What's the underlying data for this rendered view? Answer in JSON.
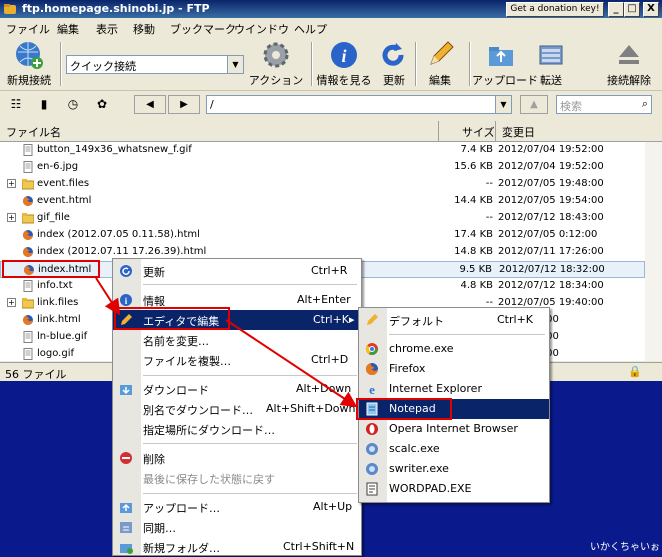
{
  "window": {
    "title": "ftp.homepage.shinobi.jp - FTP",
    "donate_label": "Get a donation key!",
    "minimize": "_",
    "maximize": "□",
    "close": "X"
  },
  "menu": [
    "ファイル",
    "編集",
    "表示",
    "移動",
    "ブックマーク",
    "ウインドウ",
    "ヘルプ"
  ],
  "toolbar": {
    "new_connection": "新規接続",
    "quick_connect": "クイック接続",
    "action": "アクション",
    "info": "情報を見る",
    "refresh": "更新",
    "edit": "編集",
    "upload": "アップロード",
    "transfer": "転送",
    "disconnect": "接続解除"
  },
  "navbar": {
    "path": "/",
    "search_placeholder": "検索"
  },
  "list": {
    "columns": {
      "name": "ファイル名",
      "size": "サイズ",
      "date": "変更日"
    },
    "rows": [
      {
        "name": "button_149x36_whatsnew_f.gif",
        "size": "7.4 KB",
        "date": "2012/07/04 19:52:00",
        "type": "file"
      },
      {
        "name": "en-6.jpg",
        "size": "15.6 KB",
        "date": "2012/07/04 19:52:00",
        "type": "file"
      },
      {
        "name": "event.files",
        "size": "--",
        "date": "2012/07/05 19:48:00",
        "type": "folder"
      },
      {
        "name": "event.html",
        "size": "14.4 KB",
        "date": "2012/07/05 19:54:00",
        "type": "html"
      },
      {
        "name": "gif_file",
        "size": "--",
        "date": "2012/07/12 18:43:00",
        "type": "folder"
      },
      {
        "name": "index (2012.07.05 0.11.58).html",
        "size": "17.4 KB",
        "date": "2012/07/05 0:12:00",
        "type": "html"
      },
      {
        "name": "index (2012.07.11 17.26.39).html",
        "size": "14.8 KB",
        "date": "2012/07/11 17:26:00",
        "type": "html"
      },
      {
        "name": "index.html",
        "size": "9.5 KB",
        "date": "2012/07/12 18:32:00",
        "type": "html"
      },
      {
        "name": "info.txt",
        "size": "4.8 KB",
        "date": "2012/07/12 18:34:00",
        "type": "file"
      },
      {
        "name": "link.files",
        "size": "--",
        "date": "2012/07/05 19:40:00",
        "type": "folder"
      },
      {
        "name": "link.html",
        "size": "",
        "date": "11 22:24:00",
        "type": "html"
      },
      {
        "name": "ln-blue.gif",
        "size": "",
        "date": "04 19:52:00",
        "type": "file"
      },
      {
        "name": "logo.gif",
        "size": "",
        "date": "04 19:52:00",
        "type": "file"
      }
    ]
  },
  "status": {
    "count": "56 ファイル"
  },
  "context_menu": {
    "refresh": {
      "label": "更新",
      "shortcut": "Ctrl+R"
    },
    "info": {
      "label": "情報",
      "shortcut": "Alt+Enter"
    },
    "edit_with": {
      "label": "エディタで編集",
      "shortcut": "Ctrl+K"
    },
    "rename": {
      "label": "名前を変更…",
      "shortcut": ""
    },
    "duplicate": {
      "label": "ファイルを複製…",
      "shortcut": "Ctrl+D"
    },
    "download": {
      "label": "ダウンロード",
      "shortcut": "Alt+Down"
    },
    "download_as": {
      "label": "別名でダウンロード…",
      "shortcut": "Alt+Shift+Down"
    },
    "download_to": {
      "label": "指定場所にダウンロード…",
      "shortcut": ""
    },
    "delete": {
      "label": "削除",
      "shortcut": ""
    },
    "revert": {
      "label": "最後に保存した状態に戻す",
      "shortcut": ""
    },
    "upload": {
      "label": "アップロード…",
      "shortcut": "Alt+Up"
    },
    "sync": {
      "label": "同期…",
      "shortcut": ""
    },
    "new_folder": {
      "label": "新規フォルダ…",
      "shortcut": "Ctrl+Shift+N"
    }
  },
  "editor_submenu": {
    "default": {
      "label": "デフォルト",
      "shortcut": "Ctrl+K"
    },
    "items": [
      "chrome.exe",
      "Firefox",
      "Internet Explorer",
      "Notepad",
      "Opera Internet Browser",
      "scalc.exe",
      "swriter.exe",
      "WORDPAD.EXE"
    ]
  },
  "watermark": "いかくちゃいぉ",
  "colors": {
    "highlight": "#0a246a",
    "annotation": "#e00000",
    "desktop": "#0a1a8c"
  }
}
